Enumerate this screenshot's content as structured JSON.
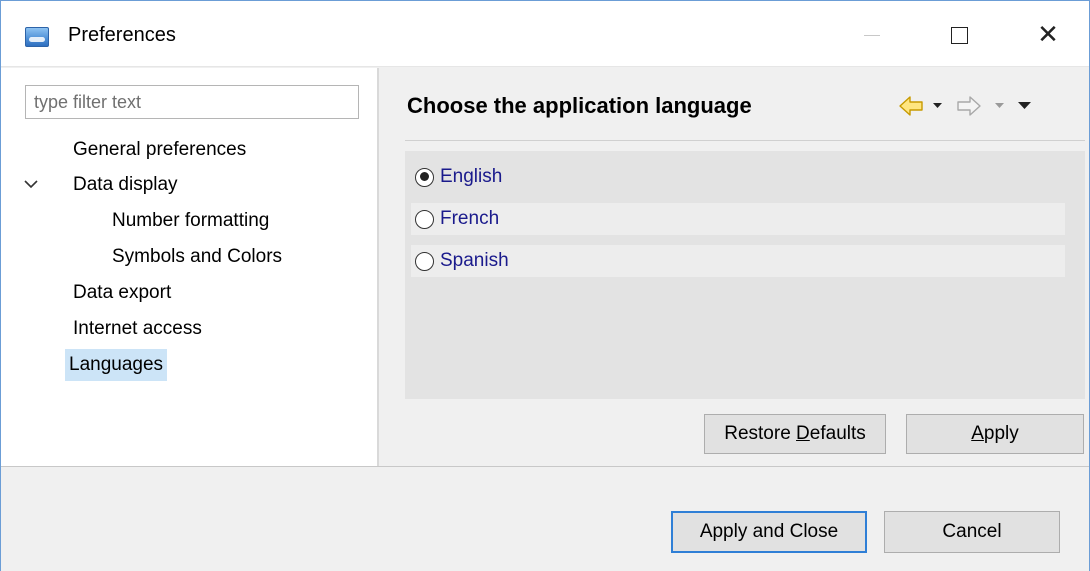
{
  "window": {
    "title": "Preferences",
    "icon": "preferences-app-icon",
    "controls": {
      "minimize": "minimize-icon",
      "maximize": "maximize-icon",
      "close": "close-icon"
    }
  },
  "filter": {
    "placeholder": "type filter text",
    "value": ""
  },
  "tree": {
    "items": [
      {
        "label": "General preferences",
        "level": 0
      },
      {
        "label": "Data display",
        "level": 0,
        "expanded": true
      },
      {
        "label": "Number formatting",
        "level": 1
      },
      {
        "label": "Symbols and Colors",
        "level": 1
      },
      {
        "label": "Data export",
        "level": 0
      },
      {
        "label": "Internet access",
        "level": 0
      },
      {
        "label": "Languages",
        "level": 0,
        "selected": true
      }
    ]
  },
  "page": {
    "title": "Choose the application language",
    "nav": {
      "back": "back-arrow-icon",
      "back_menu": "dropdown-triangle-icon",
      "forward": "forward-arrow-icon",
      "forward_menu": "dropdown-triangle-icon",
      "view_menu": "view-menu-icon"
    },
    "languages": [
      {
        "label": "English",
        "checked": true
      },
      {
        "label": "French",
        "checked": false
      },
      {
        "label": "Spanish",
        "checked": false
      }
    ],
    "restore_defaults_pre": "Restore ",
    "restore_defaults_mnemonic": "D",
    "restore_defaults_post": "efaults",
    "apply_mnemonic": "A",
    "apply_post": "pply"
  },
  "footer": {
    "apply_and_close": "Apply and Close",
    "cancel": "Cancel"
  },
  "colors": {
    "accent_focus": "#2f7fd6",
    "selection": "#cce4f7",
    "radio_label": "#1a1a8c",
    "back_arrow": "#f0c000"
  }
}
